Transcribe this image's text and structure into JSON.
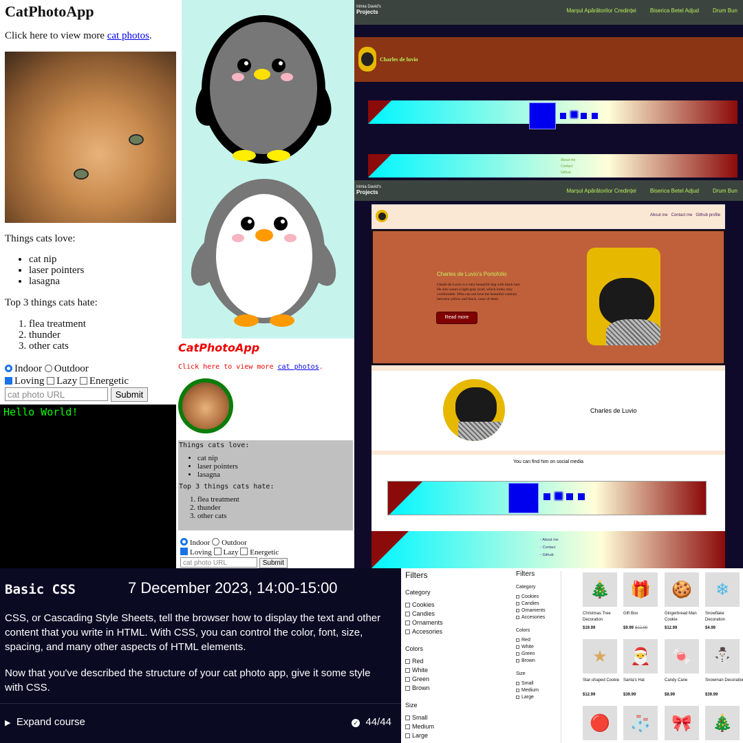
{
  "cat_app_1": {
    "title": "CatPhotoApp",
    "intro_text": "Click here to view more",
    "intro_link": "cat photos",
    "intro_end": ".",
    "loves_title": "Things cats love:",
    "loves": [
      "cat nip",
      "laser pointers",
      "lasagna"
    ],
    "hates_title": "Top 3 things cats hate:",
    "hates": [
      "flea treatment",
      "thunder",
      "other cats"
    ],
    "radio_indoor": "Indoor",
    "radio_outdoor": "Outdoor",
    "check_loving": "Loving",
    "check_lazy": "Lazy",
    "check_energetic": "Energetic",
    "url_placeholder": "cat photo URL",
    "submit": "Submit"
  },
  "terminal": {
    "text": "Hello World!"
  },
  "cat_app_2": {
    "title": "CatPhotoApp",
    "intro_text": "Click here to view more",
    "intro_link": "cat photos",
    "intro_end": ".",
    "loves_title": "Things cats love:",
    "loves": [
      "cat nip",
      "laser pointers",
      "lasagna"
    ],
    "hates_title": "Top 3 things cats hate:",
    "hates": [
      "flea treatment",
      "thunder",
      "other cats"
    ],
    "radio_indoor": "Indoor",
    "radio_outdoor": "Outdoor",
    "check_loving": "Loving",
    "check_lazy": "Lazy",
    "check_energetic": "Energetic",
    "url_placeholder": "cat photo URL",
    "submit": "Submit"
  },
  "portfolio_top": {
    "brand_small": "Irimia David's",
    "brand_big": "Projects",
    "nav": [
      "Marșul Apărătorilor Credinței",
      "Biserica Betel Adjud",
      "Drum Bun"
    ],
    "profile_name": "Charles de luvio",
    "footer_links": [
      "About me",
      "Contact",
      "Github"
    ]
  },
  "portfolio_main": {
    "brand_small": "Irimia David's",
    "brand_big": "Projects",
    "nav": [
      "Marșul Apărătorilor Credinței",
      "Biserica Betel Adjud",
      "Drum Bun"
    ],
    "inner_nav": [
      "About me",
      "Contact me",
      "Github profile"
    ],
    "hero_title": "Charles de Luvio's Portofolio",
    "hero_text": "Charle de Luvio is a very beautiful dog with black hair. He also wears a light gray scarf, which looks very comfortable. Who can not love the beautiful contrast between yellow and black, none of them.",
    "read_more": "Read more",
    "profile_name": "Charles de Luvio",
    "social_text": "You can find him on social media",
    "footer_links": [
      "About me",
      "Contact",
      "Github"
    ]
  },
  "course": {
    "title": "Basic CSS",
    "date": "7 December 2023, 14:00-15:00",
    "para1": "CSS, or Cascading Style Sheets, tell the browser how to display the text and other content that you write in HTML. With CSS, you can control the color, font, size, spacing, and many other aspects of HTML elements.",
    "para2": "Now that you've described the structure of your cat photo app, give it some style with CSS.",
    "expand": "Expand course",
    "progress": "44/44"
  },
  "shop": {
    "filters_title": "Filters",
    "category_title": "Category",
    "categories": [
      "Cookies",
      "Candies",
      "Ornaments",
      "Accesories"
    ],
    "colors_title": "Colors",
    "colors": [
      "Red",
      "White",
      "Green",
      "Brown"
    ],
    "size_title": "Size",
    "sizes": [
      "Small",
      "Medium",
      "Large"
    ],
    "products": [
      {
        "name": "Christmas Tree Decoration",
        "price": "$19.99",
        "old": "",
        "icon": "🎄"
      },
      {
        "name": "Gift Box",
        "price": "$9.99",
        "old": "$12.99",
        "icon": "🎁"
      },
      {
        "name": "Gingerbread Man Cookie",
        "price": "$12.99",
        "old": "",
        "icon": "🍪"
      },
      {
        "name": "Snowflake Decoration",
        "price": "$4.99",
        "old": "",
        "icon": "❄"
      },
      {
        "name": "Star-shaped Cookie",
        "price": "$12.99",
        "old": "",
        "icon": "★"
      },
      {
        "name": "Santa's Hat",
        "price": "$39.99",
        "old": "",
        "icon": "🎅"
      },
      {
        "name": "Candy Cane",
        "price": "$8.99",
        "old": "",
        "icon": "🍬"
      },
      {
        "name": "Snowman Decoration",
        "price": "$39.99",
        "old": "",
        "icon": "⛄"
      },
      {
        "name": "",
        "price": "",
        "old": "",
        "icon": "🔴"
      },
      {
        "name": "",
        "price": "",
        "old": "",
        "icon": "🧦"
      },
      {
        "name": "",
        "price": "",
        "old": "",
        "icon": "🎀"
      },
      {
        "name": "",
        "price": "",
        "old": "",
        "icon": "🎄"
      }
    ]
  }
}
